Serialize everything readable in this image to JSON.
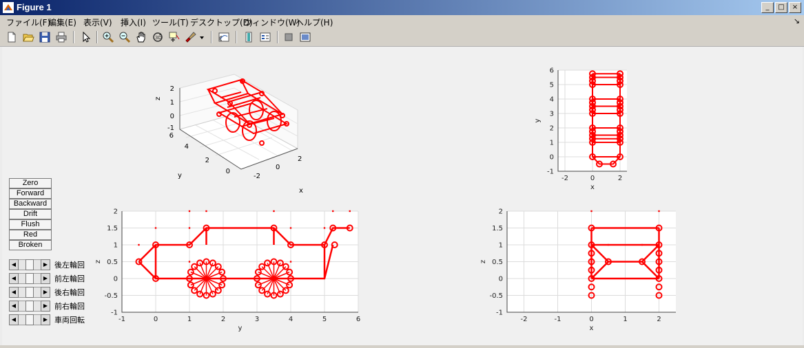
{
  "window": {
    "title": "Figure 1",
    "controls": [
      "_",
      "□",
      "×"
    ]
  },
  "menubar": {
    "items": [
      "ファイル(F)",
      "編集(E)",
      "表示(V)",
      "挿入(I)",
      "ツール(T)",
      "デスクトップ(D)",
      "ウィンドウ(W)",
      "ヘルプ(H)"
    ]
  },
  "toolbar": {
    "icons": [
      "new-figure-icon",
      "open-file-icon",
      "save-icon",
      "print-icon",
      "arrow-pointer-icon",
      "zoom-in-icon",
      "zoom-out-icon",
      "pan-hand-icon",
      "rotate-3d-icon",
      "data-cursor-icon",
      "brush-icon",
      "link-plot-icon",
      "colorbar-icon",
      "legend-icon",
      "hide-plot-tools-icon",
      "show-plot-tools-icon"
    ]
  },
  "controls": {
    "buttons": [
      "Zero",
      "Forward",
      "Backward",
      "Drift",
      "Flush",
      "Red",
      "Broken"
    ],
    "sliders": [
      {
        "label": "後左輪回",
        "value": 0.5
      },
      {
        "label": "前左輪回",
        "value": 0.5
      },
      {
        "label": "後右輪回",
        "value": 0.5
      },
      {
        "label": "前右輪回",
        "value": 0.5
      },
      {
        "label": "車両回転",
        "value": 0.5
      }
    ]
  },
  "colors": {
    "plot_color": "#ff0000",
    "grid_color": "#dcdcdc",
    "axes_bg": "#ffffff"
  },
  "chart_data": [
    {
      "type": "3d-line",
      "title": "",
      "xlabel": "x",
      "ylabel": "y",
      "zlabel": "z",
      "xticks": [
        "-2",
        "0",
        "2"
      ],
      "yticks": [
        "0",
        "2",
        "4",
        "6"
      ],
      "zticks": [
        "-1",
        "0",
        "1",
        "2"
      ],
      "grid": true
    },
    {
      "type": "line",
      "title": "",
      "xlabel": "x",
      "ylabel": "y",
      "xlim": [
        -2.5,
        2.5
      ],
      "ylim": [
        -1,
        6
      ],
      "xticks": [
        "-2",
        "0",
        "2"
      ],
      "yticks": [
        "-1",
        "0",
        "1",
        "2",
        "3",
        "4",
        "5",
        "6"
      ],
      "grid": true,
      "rails_x": [
        0,
        2
      ],
      "rungs_y": [
        5.75,
        5.5,
        5.0,
        4.0,
        3.5,
        3.0,
        2.0,
        1.5,
        1.25,
        1.0,
        0.0
      ],
      "front": {
        "points": [
          [
            0,
            0
          ],
          [
            0.5,
            -0.5
          ],
          [
            1.5,
            -0.5
          ],
          [
            2,
            0
          ]
        ]
      },
      "circles_y": [
        5.75,
        5.5,
        5.25,
        5.0,
        4.0,
        3.75,
        3.5,
        3.25,
        3.0,
        2.0,
        1.75,
        1.5,
        1.25,
        1.0,
        0.0,
        -0.5
      ]
    },
    {
      "type": "line",
      "title": "",
      "xlabel": "y",
      "ylabel": "z",
      "xlim": [
        -1,
        6
      ],
      "ylim": [
        -1,
        2
      ],
      "xticks": [
        "-1",
        "0",
        "1",
        "2",
        "3",
        "4",
        "5",
        "6"
      ],
      "yticks": [
        "-1",
        "-0.5",
        "0",
        "0.5",
        "1",
        "1.5",
        "2"
      ],
      "grid": true,
      "wheels": [
        {
          "center": [
            1.5,
            0
          ],
          "radius": 0.5
        },
        {
          "center": [
            3.5,
            0
          ],
          "radius": 0.5
        }
      ],
      "outline": [
        [
          -0.5,
          0.5
        ],
        [
          0,
          1
        ],
        [
          1,
          1
        ],
        [
          1.5,
          1.5
        ],
        [
          3.5,
          1.5
        ],
        [
          4,
          1
        ],
        [
          5,
          1
        ],
        [
          5.25,
          1.5
        ],
        [
          5.75,
          1.5
        ]
      ],
      "outline2": [
        [
          -0.5,
          0.5
        ],
        [
          0,
          0
        ],
        [
          5,
          0
        ],
        [
          5.25,
          1
        ]
      ],
      "verticals": [
        [
          0,
          0,
          0,
          1
        ],
        [
          5,
          0,
          5,
          1
        ],
        [
          1.5,
          1,
          1.5,
          1.5
        ],
        [
          3.5,
          1,
          3.5,
          1.5
        ]
      ],
      "dots": [
        [
          -0.5,
          1
        ],
        [
          0,
          1.5
        ],
        [
          1,
          1.5
        ],
        [
          1,
          2
        ],
        [
          1.5,
          2
        ],
        [
          3.5,
          2
        ],
        [
          4,
          1.5
        ],
        [
          5,
          1.5
        ],
        [
          5.25,
          2
        ],
        [
          5.75,
          2
        ],
        [
          4,
          0.5
        ],
        [
          1,
          0.5
        ]
      ]
    },
    {
      "type": "line",
      "title": "",
      "xlabel": "x",
      "ylabel": "z",
      "xlim": [
        -2.5,
        2.5
      ],
      "ylim": [
        -1,
        2
      ],
      "xticks": [
        "-2",
        "-1",
        "0",
        "1",
        "2"
      ],
      "yticks": [
        "-1",
        "-0.5",
        "0",
        "0.5",
        "1",
        "1.5",
        "2"
      ],
      "grid": true,
      "segments": [
        [
          0,
          0,
          0,
          1.5
        ],
        [
          2,
          0,
          2,
          1.5
        ],
        [
          0,
          1.5,
          2,
          1.5
        ],
        [
          0,
          1,
          2,
          1
        ],
        [
          0,
          1,
          0.5,
          0.5
        ],
        [
          2,
          1,
          1.5,
          0.5
        ],
        [
          0.5,
          0.5,
          1.5,
          0.5
        ],
        [
          0,
          0,
          0.5,
          0.5
        ],
        [
          2,
          0,
          1.5,
          0.5
        ],
        [
          0,
          0,
          2,
          0
        ]
      ],
      "circles": [
        [
          0,
          1.5
        ],
        [
          2,
          1.5
        ],
        [
          0,
          1
        ],
        [
          2,
          1
        ],
        [
          0.5,
          0.5
        ],
        [
          1.5,
          0.5
        ],
        [
          0,
          0.5
        ],
        [
          0,
          0.25
        ],
        [
          0,
          0
        ],
        [
          0,
          -0.25
        ],
        [
          0,
          -0.5
        ],
        [
          2,
          0.5
        ],
        [
          2,
          0.25
        ],
        [
          2,
          0
        ],
        [
          2,
          -0.25
        ],
        [
          2,
          -0.5
        ],
        [
          0,
          0.75
        ],
        [
          2,
          0.75
        ]
      ],
      "dots": [
        [
          0,
          2
        ],
        [
          2,
          2
        ],
        [
          0.5,
          1
        ],
        [
          1.5,
          1
        ]
      ]
    }
  ]
}
